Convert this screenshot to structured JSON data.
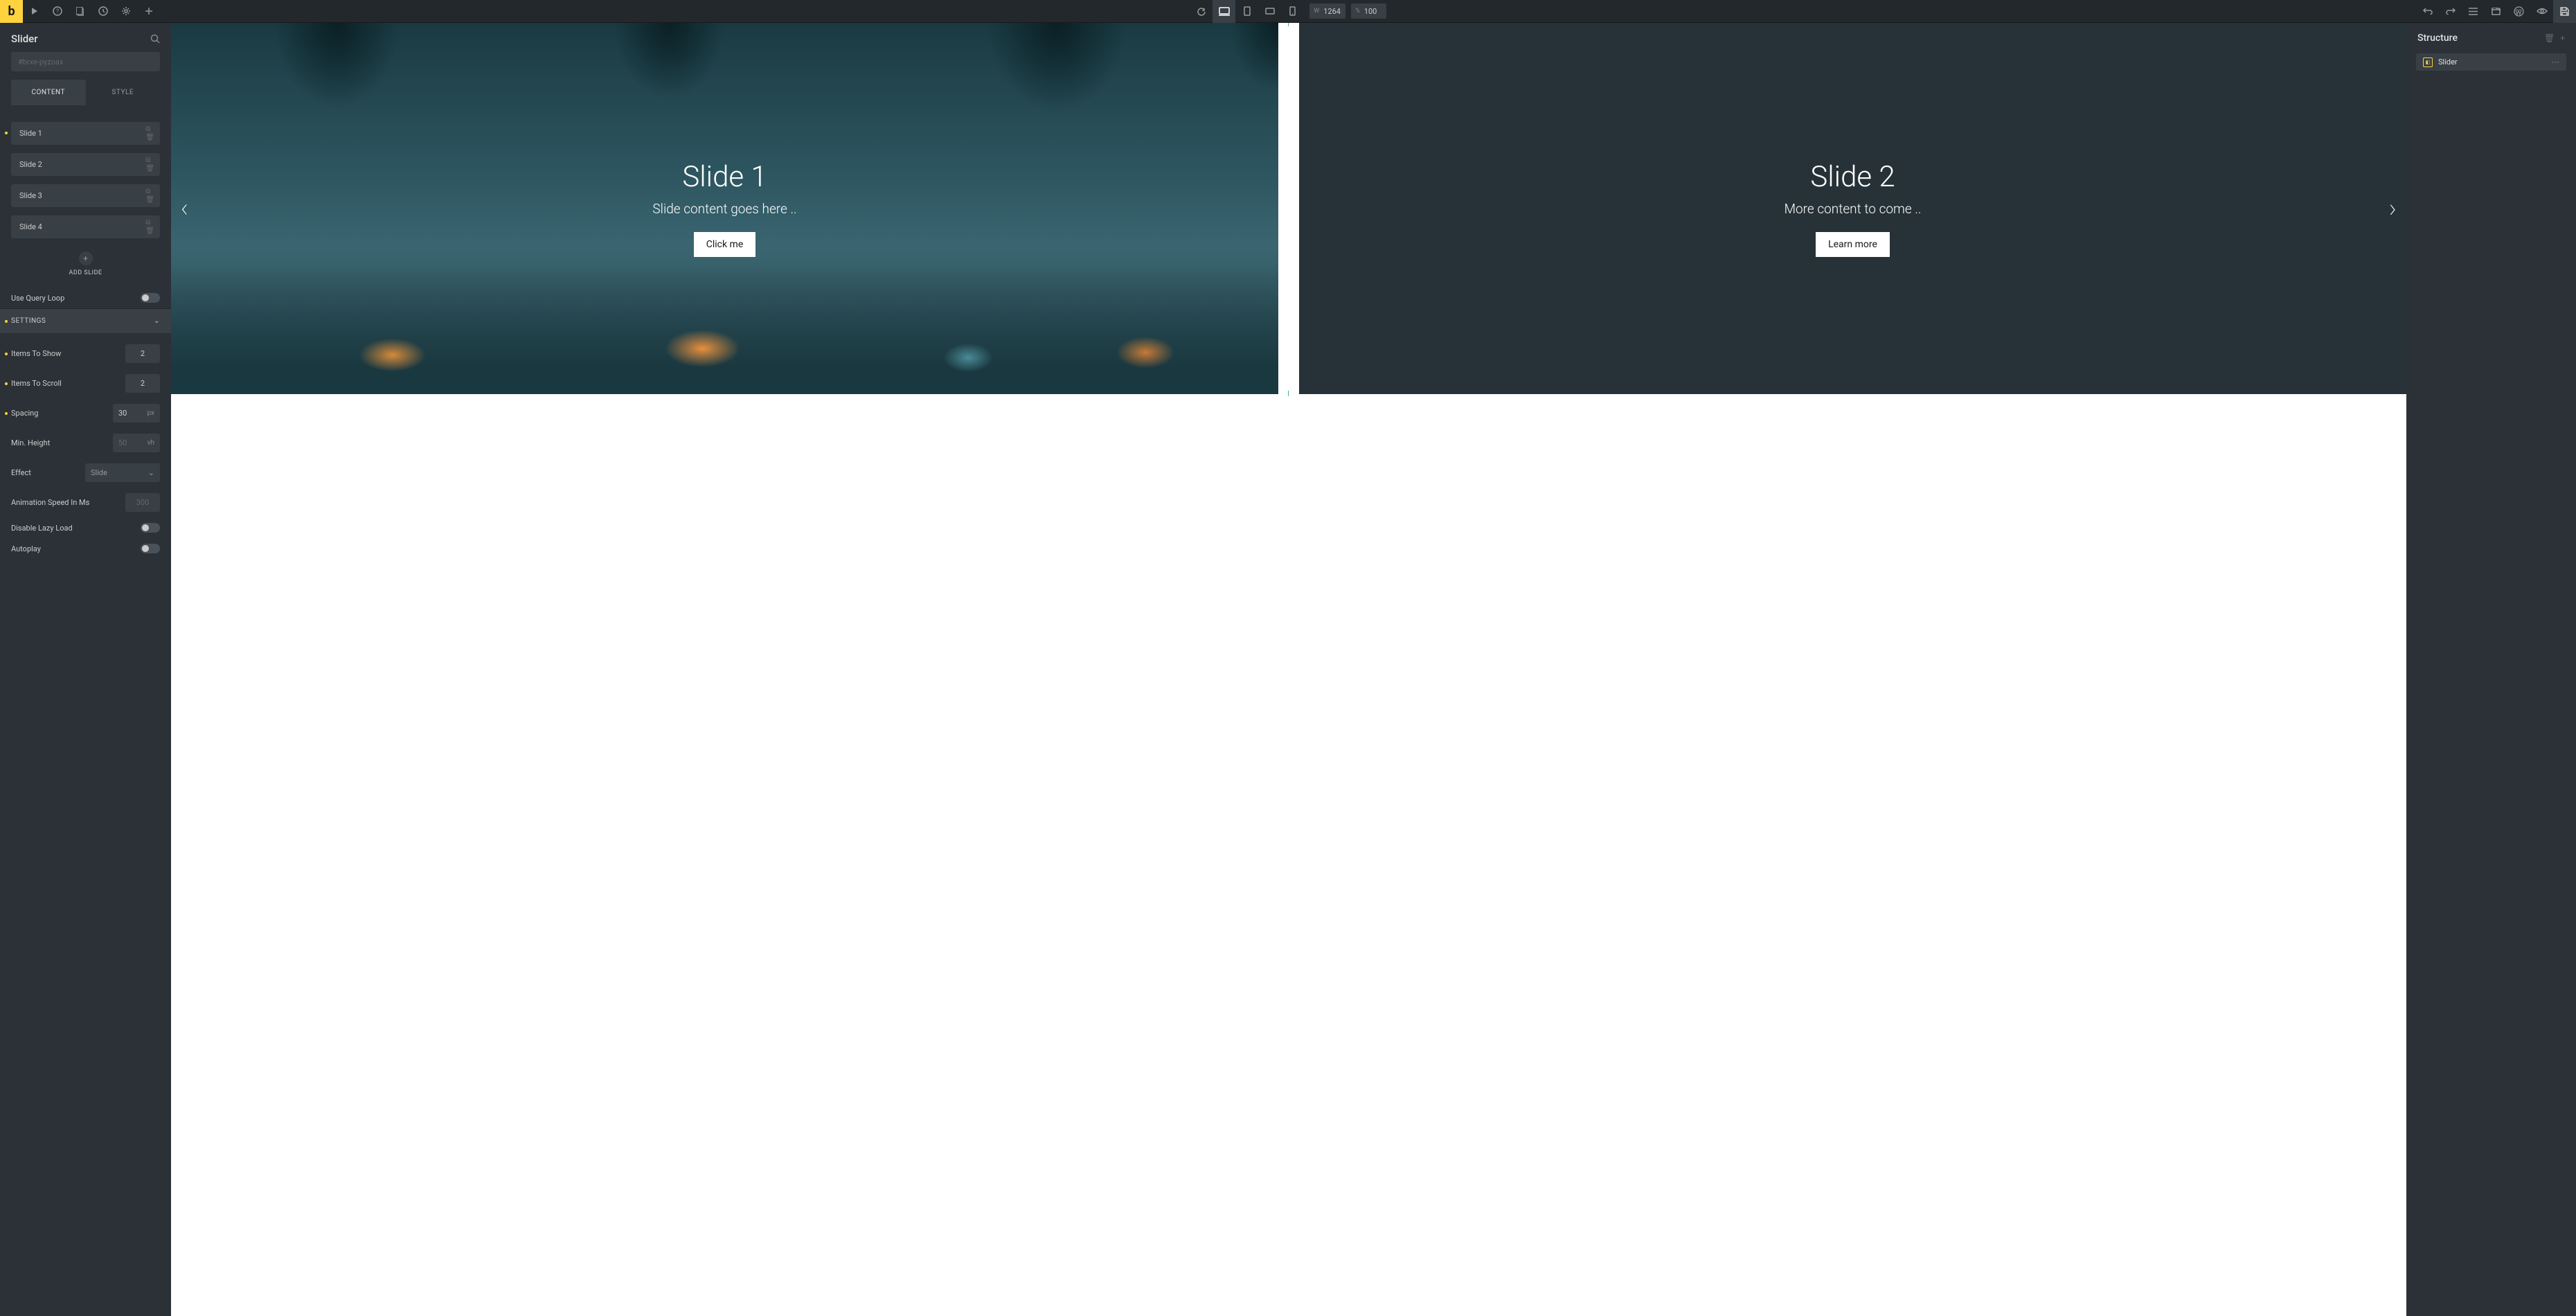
{
  "toolbar": {
    "logo": "b",
    "width_label": "W",
    "width_value": "1264",
    "percent_label": "%",
    "percent_value": "100"
  },
  "leftPanel": {
    "title": "Slider",
    "idPlaceholder": "#brxe-pyzoax",
    "tabs": {
      "content": "CONTENT",
      "style": "STYLE"
    },
    "slides": [
      "Slide 1",
      "Slide 2",
      "Slide 3",
      "Slide 4"
    ],
    "addSlide": "ADD SLIDE",
    "queryLoop": "Use Query Loop",
    "settingsHeader": "SETTINGS",
    "settings": {
      "itemsToShow": {
        "label": "Items To Show",
        "value": "2"
      },
      "itemsToScroll": {
        "label": "Items To Scroll",
        "value": "2"
      },
      "spacing": {
        "label": "Spacing",
        "value": "30",
        "unit": "px"
      },
      "minHeight": {
        "label": "Min. Height",
        "value": "50",
        "unit": "vh"
      },
      "effect": {
        "label": "Effect",
        "value": "Slide"
      },
      "animSpeed": {
        "label": "Animation Speed In Ms",
        "value": "300"
      },
      "lazyLoad": "Disable Lazy Load",
      "autoplay": "Autoplay"
    }
  },
  "canvas": {
    "slide1": {
      "title": "Slide 1",
      "content": "Slide content goes here ..",
      "button": "Click me"
    },
    "slide2": {
      "title": "Slide 2",
      "content": "More content to come ..",
      "button": "Learn more"
    }
  },
  "rightPanel": {
    "title": "Structure",
    "item": "Slider"
  }
}
